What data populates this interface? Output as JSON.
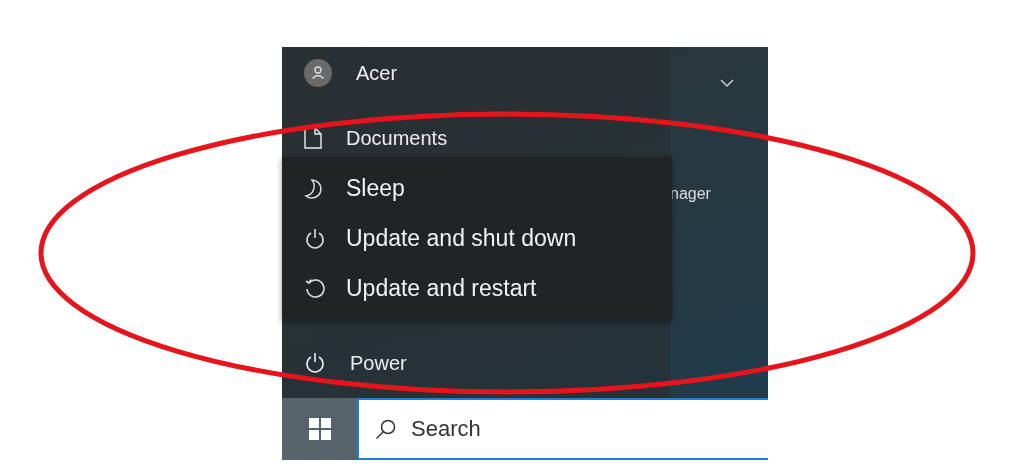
{
  "start_menu": {
    "user": {
      "name": "Acer"
    },
    "places": [
      {
        "label": "Documents",
        "kind": "document"
      }
    ],
    "power": {
      "label": "Power"
    },
    "tile_pane": {
      "tile_label": "nager"
    }
  },
  "power_menu": {
    "items": [
      {
        "label": "Sleep",
        "kind": "sleep"
      },
      {
        "label": "Update and shut down",
        "kind": "shutdown"
      },
      {
        "label": "Update and restart",
        "kind": "restart"
      }
    ]
  },
  "taskbar": {
    "search": {
      "placeholder": "Search"
    }
  },
  "annotation": {
    "kind": "ellipse"
  }
}
